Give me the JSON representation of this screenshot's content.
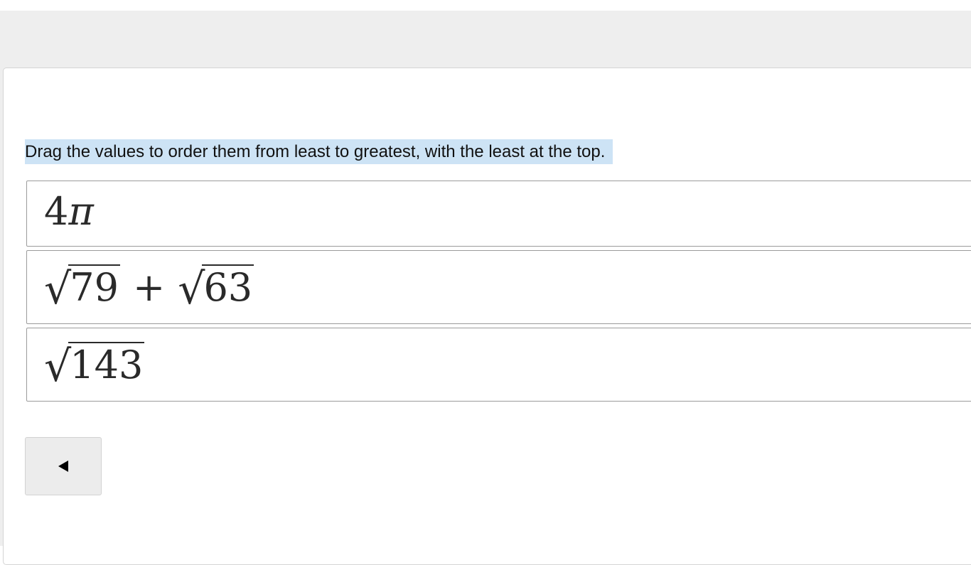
{
  "instruction": "Drag the values to order them from least to greatest, with the least at the top.",
  "items": [
    {
      "coefficient": "4",
      "symbol": "π"
    },
    {
      "radicand_a": "79",
      "operator": "+",
      "radicand_b": "63"
    },
    {
      "radicand": "143"
    }
  ],
  "back_button": {
    "icon": "back-arrow-icon"
  },
  "colors": {
    "highlight": "#cde3f5",
    "header_band": "#eeeeee",
    "item_border": "#9b9b9b",
    "button_bg": "#ececec"
  }
}
